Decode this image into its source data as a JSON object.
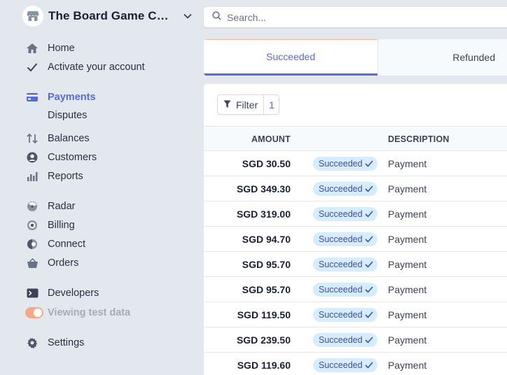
{
  "brand": {
    "name": "The Board Game Comp..."
  },
  "nav": {
    "home": "Home",
    "activate": "Activate your account",
    "payments": "Payments",
    "disputes": "Disputes",
    "balances": "Balances",
    "customers": "Customers",
    "reports": "Reports",
    "radar": "Radar",
    "billing": "Billing",
    "connect": "Connect",
    "orders": "Orders",
    "developers": "Developers",
    "test_data": "Viewing test data",
    "settings": "Settings"
  },
  "search": {
    "placeholder": "Search..."
  },
  "tabs": {
    "succeeded": "Succeeded",
    "refunded": "Refunded"
  },
  "filter": {
    "label": "Filter",
    "count": "1"
  },
  "table": {
    "headers": {
      "amount": "AMOUNT",
      "description": "DESCRIPTION"
    },
    "rows": [
      {
        "amount": "SGD 30.50",
        "status": "Succeeded",
        "description": "Payment"
      },
      {
        "amount": "SGD 349.30",
        "status": "Succeeded",
        "description": "Payment"
      },
      {
        "amount": "SGD 319.00",
        "status": "Succeeded",
        "description": "Payment"
      },
      {
        "amount": "SGD 94.70",
        "status": "Succeeded",
        "description": "Payment"
      },
      {
        "amount": "SGD 95.70",
        "status": "Succeeded",
        "description": "Payment"
      },
      {
        "amount": "SGD 95.70",
        "status": "Succeeded",
        "description": "Payment"
      },
      {
        "amount": "SGD 119.50",
        "status": "Succeeded",
        "description": "Payment"
      },
      {
        "amount": "SGD 239.50",
        "status": "Succeeded",
        "description": "Payment"
      },
      {
        "amount": "SGD 119.60",
        "status": "Succeeded",
        "description": "Payment"
      }
    ]
  },
  "colors": {
    "accent": "#556cd6",
    "badge_bg": "#d6ecff",
    "badge_text": "#3d4eac",
    "toggle": "#f8a68c"
  }
}
